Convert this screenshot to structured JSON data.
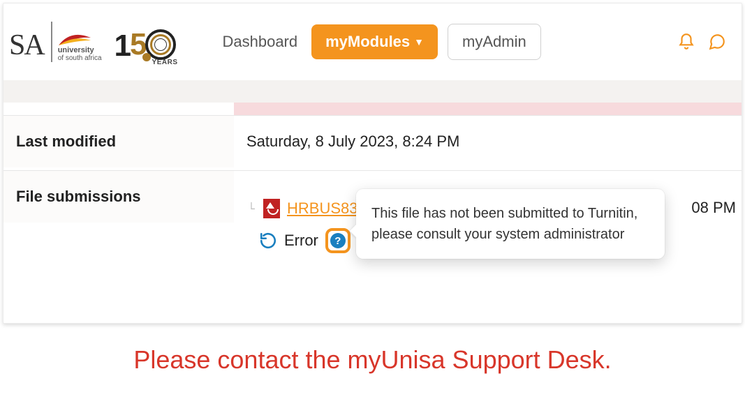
{
  "header": {
    "logo_text": "SA",
    "university_line1": "university",
    "university_line2": "of south africa",
    "years_label": "YEARS",
    "nav": {
      "dashboard": "Dashboard",
      "mymodules": "myModules",
      "myadmin": "myAdmin"
    }
  },
  "rows": {
    "last_modified": {
      "label": "Last modified",
      "value": "Saturday, 8 July 2023, 8:24 PM"
    },
    "file_submissions": {
      "label": "File submissions",
      "file_name": "HRBUS83",
      "file_time_suffix": "08 PM",
      "error_label": "Error",
      "tooltip": "This file has not been submitted to Turnitin, please consult your system administrator"
    }
  },
  "footer_message": "Please contact the myUnisa Support Desk."
}
